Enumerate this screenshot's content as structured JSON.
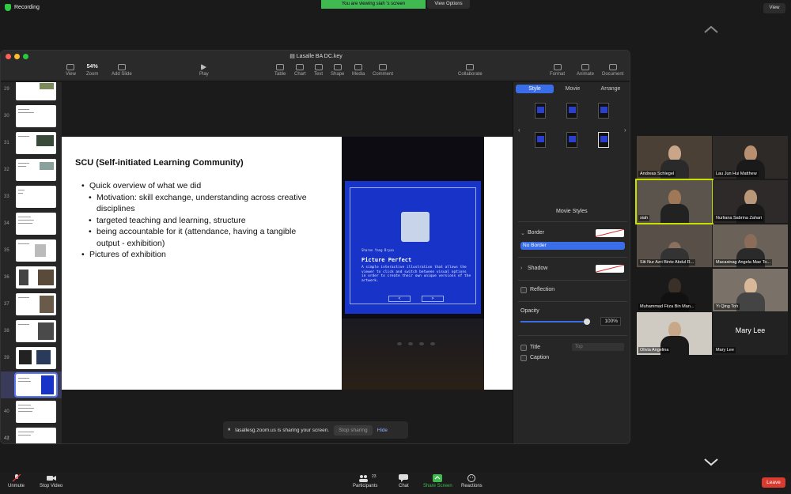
{
  "zoom": {
    "recording_label": "Recording",
    "viewing_banner": "You are viewing siah 's screen",
    "view_options": "View Options",
    "view_button": "View",
    "sharing_banner": "lasallesg.zoom.us is sharing your screen.",
    "stop_sharing": "Stop sharing",
    "hide": "Hide",
    "bottom": {
      "unmute": "Unmute",
      "stop_video": "Stop Video",
      "participants": "Participants",
      "participants_count": "23",
      "chat": "Chat",
      "share_screen": "Share Screen",
      "reactions": "Reactions",
      "leave": "Leave"
    }
  },
  "keynote": {
    "window_title": "Lasalle BA DC.key",
    "toolbar": {
      "view": "View",
      "zoom_value": "54%",
      "zoom": "Zoom",
      "add_slide": "Add Slide",
      "play": "Play",
      "table": "Table",
      "chart": "Chart",
      "text": "Text",
      "shape": "Shape",
      "media": "Media",
      "comment": "Comment",
      "collaborate": "Collaborate",
      "format": "Format",
      "animate": "Animate",
      "document": "Document"
    },
    "slide_numbers": [
      "29",
      "30",
      "31",
      "32",
      "33",
      "34",
      "35",
      "36",
      "37",
      "38",
      "39",
      "40",
      "41",
      "42"
    ],
    "slide": {
      "title": "SCU (Self-initiated Learning Community)",
      "bullets": [
        "Quick overview of what we did",
        "Motivation: skill exchange, understanding across creative disciplines",
        "targeted teaching and learning, structure",
        "being accountable for it (attendance, having a tangible output - exhibition)",
        "Pictures of exhibition"
      ],
      "photo": {
        "author": "Sharon Yang Bryan",
        "title": "Picture Perfect",
        "description": "A simple interactive illustration that allows the viewer to click and switch between visual options in order to create their own unique versions of the artwork.",
        "prev": "<",
        "next": ">"
      }
    },
    "inspector": {
      "tabs": [
        "Style",
        "Movie",
        "Arrange"
      ],
      "movie_styles": "Movie Styles",
      "border": "Border",
      "border_value": "No Border",
      "shadow": "Shadow",
      "reflection": "Reflection",
      "opacity": "Opacity",
      "opacity_value": "100%",
      "opacity_level": 1.0,
      "title": "Title",
      "title_pos": "Top",
      "caption": "Caption"
    }
  },
  "participants": [
    "Andreas Schlegel",
    "Lau Jun Hui Matthew",
    "siah",
    "Nurliana Sabrina Zahari",
    "Siti Nur Azri Binte Abdul R...",
    "Macasinag Angela Mae To...",
    "Muhammad Fiiza Bin Man...",
    "Yi Qing Toh",
    "Olivia Angelina",
    "Mary Lee"
  ],
  "participant_big_name": "Mary Lee"
}
